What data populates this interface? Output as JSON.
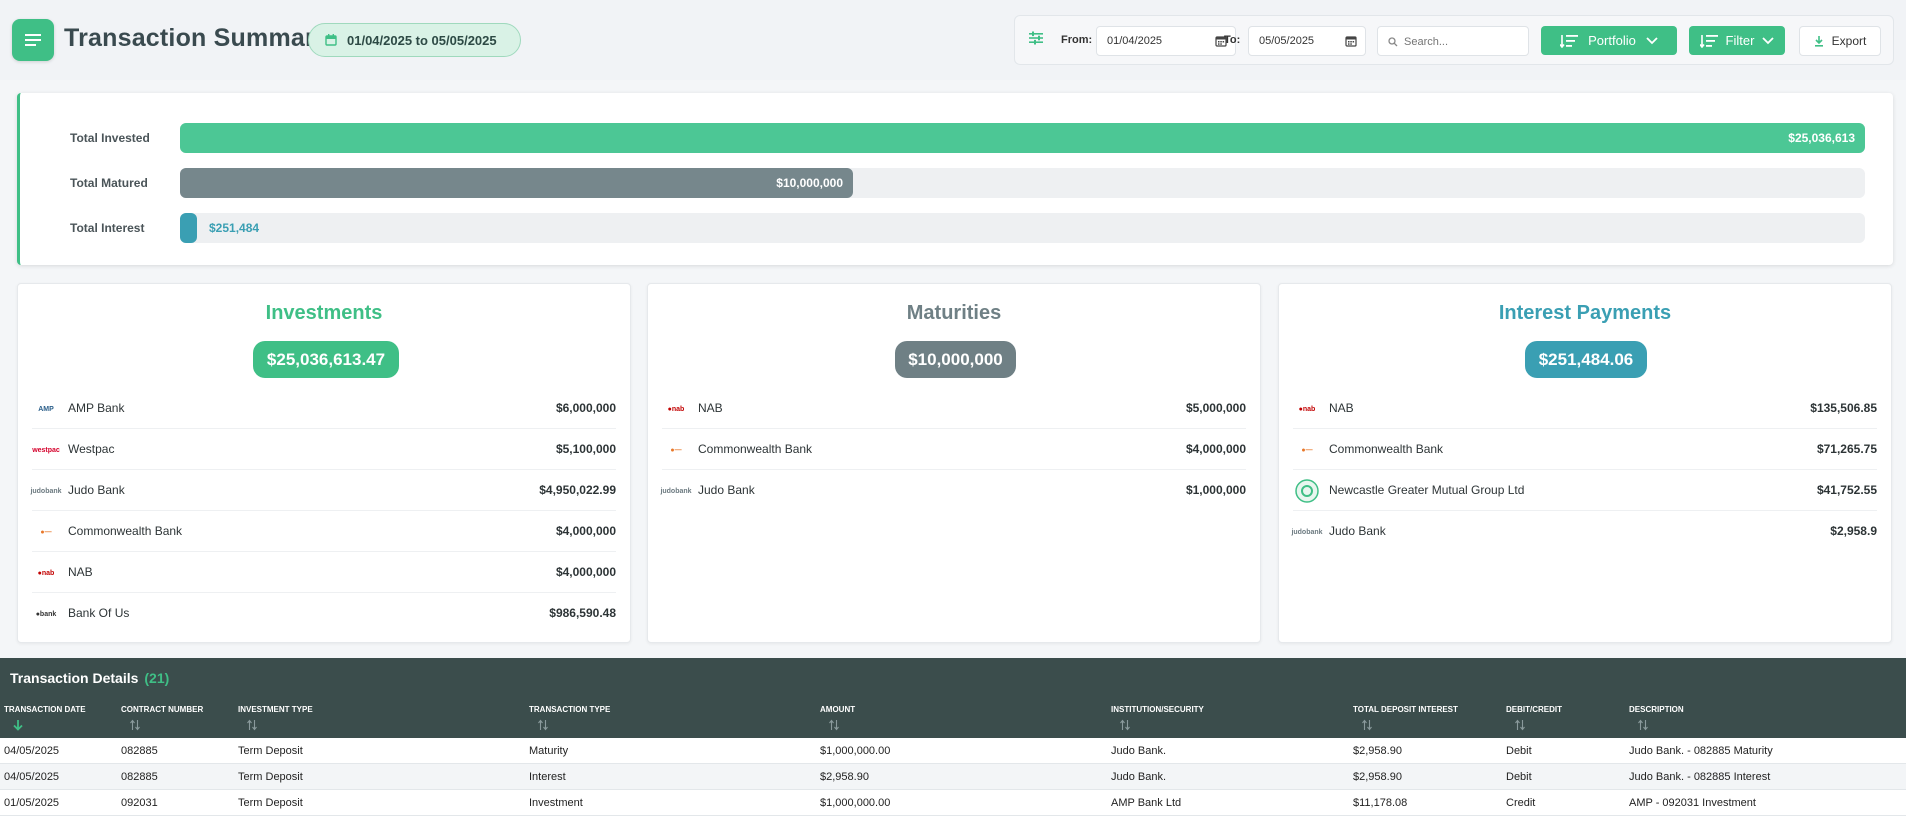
{
  "header": {
    "title": "Transaction Summary",
    "date_range": "01/04/2025 to 05/05/2025"
  },
  "toolbar": {
    "from_label": "From:",
    "from_value": "01/04/2025",
    "to_label": "To:",
    "to_value": "05/05/2025",
    "search_placeholder": "Search...",
    "portfolio_label": "Portfolio",
    "filter_label": "Filter",
    "export_label": "Export"
  },
  "summary": {
    "invested_label": "Total Invested",
    "invested_value": "$25,036,613",
    "invested_fraction": 1.0,
    "matured_label": "Total Matured",
    "matured_value": "$10,000,000",
    "matured_fraction": 0.3994,
    "interest_label": "Total Interest",
    "interest_value": "$251,484",
    "interest_fraction": 0.01,
    "colors": {
      "invested": "#4cc795",
      "matured": "#76878c",
      "interest": "#3a9fb3"
    }
  },
  "investments": {
    "title": "Investments",
    "total": "$25,036,613.47",
    "color": "#3fbf86",
    "rows": [
      {
        "name": "AMP Bank",
        "amount": "$6,000,000",
        "logo": "amp-logo"
      },
      {
        "name": "Westpac",
        "amount": "$5,100,000",
        "logo": "westpac-logo"
      },
      {
        "name": "Judo Bank",
        "amount": "$4,950,022.99",
        "logo": "judo-logo"
      },
      {
        "name": "Commonwealth Bank",
        "amount": "$4,000,000",
        "logo": "cba-logo"
      },
      {
        "name": "NAB",
        "amount": "$4,000,000",
        "logo": "nab-logo"
      },
      {
        "name": "Bank Of Us",
        "amount": "$986,590.48",
        "logo": "bankofus-logo"
      }
    ]
  },
  "maturities": {
    "title": "Maturities",
    "total": "$10,000,000",
    "color": "#6f8085",
    "rows": [
      {
        "name": "NAB",
        "amount": "$5,000,000",
        "logo": "nab-logo"
      },
      {
        "name": "Commonwealth Bank",
        "amount": "$4,000,000",
        "logo": "cba-logo"
      },
      {
        "name": "Judo Bank",
        "amount": "$1,000,000",
        "logo": "judo-logo"
      }
    ]
  },
  "interest": {
    "title": "Interest Payments",
    "total": "$251,484.06",
    "color": "#3a9fb3",
    "rows": [
      {
        "name": "NAB",
        "amount": "$135,506.85",
        "logo": "nab-logo"
      },
      {
        "name": "Commonwealth Bank",
        "amount": "$71,265.75",
        "logo": "cba-logo"
      },
      {
        "name": "Newcastle Greater Mutual Group Ltd",
        "amount": "$41,752.55",
        "logo": "newcastle-logo"
      },
      {
        "name": "Judo Bank",
        "amount": "$2,958.9",
        "logo": "judo-logo"
      }
    ]
  },
  "details": {
    "title": "Transaction Details",
    "count": "(21)",
    "columns": [
      "Transaction Date",
      "Contract Number",
      "Investment Type",
      "Transaction Type",
      "Amount",
      "Institution/Security",
      "Total Deposit Interest",
      "Debit/Credit",
      "Description"
    ],
    "rows": [
      [
        "04/05/2025",
        "082885",
        "Term Deposit",
        "Maturity",
        "$1,000,000.00",
        "Judo Bank.",
        "$2,958.90",
        "Debit",
        "Judo Bank. - 082885 Maturity"
      ],
      [
        "04/05/2025",
        "082885",
        "Term Deposit",
        "Interest",
        "$2,958.90",
        "Judo Bank.",
        "$2,958.90",
        "Debit",
        "Judo Bank. - 082885 Interest"
      ],
      [
        "01/05/2025",
        "092031",
        "Term Deposit",
        "Investment",
        "$1,000,000.00",
        "AMP Bank Ltd",
        "$11,178.08",
        "Credit",
        "AMP - 092031 Investment"
      ]
    ]
  }
}
